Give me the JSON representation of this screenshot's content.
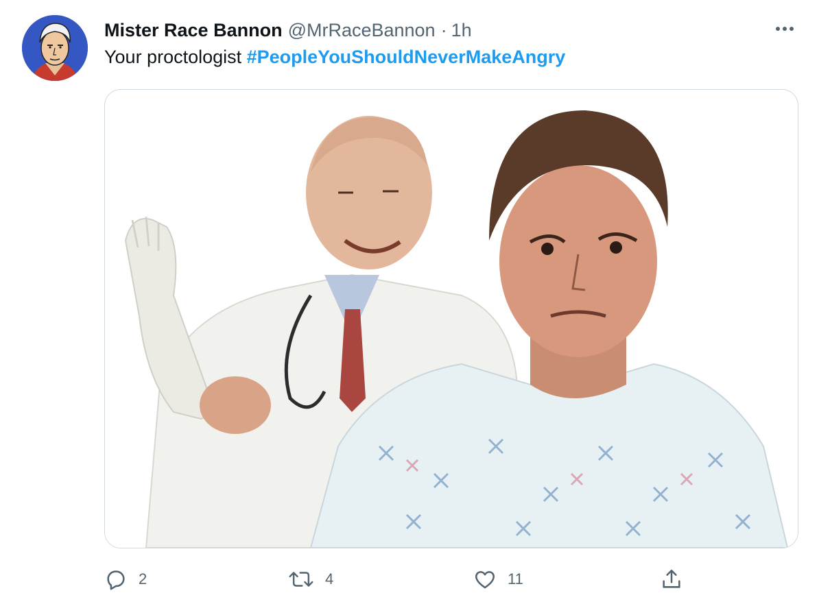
{
  "tweet": {
    "author_name": "Mister Race Bannon",
    "author_handle": "@MrRaceBannon",
    "separator": "·",
    "time": "1h",
    "text_plain": "Your proctologist ",
    "hashtag": "#PeopleYouShouldNeverMakeAngry"
  },
  "actions": {
    "reply_count": "2",
    "retweet_count": "4",
    "like_count": "11"
  },
  "icons": {
    "more": "more-horizontal-icon",
    "reply": "reply-icon",
    "retweet": "retweet-icon",
    "like": "heart-icon",
    "share": "share-icon"
  },
  "colors": {
    "accent": "#1d9bf0",
    "text": "#0f1419",
    "secondary": "#536471",
    "border": "#cfd9de"
  }
}
